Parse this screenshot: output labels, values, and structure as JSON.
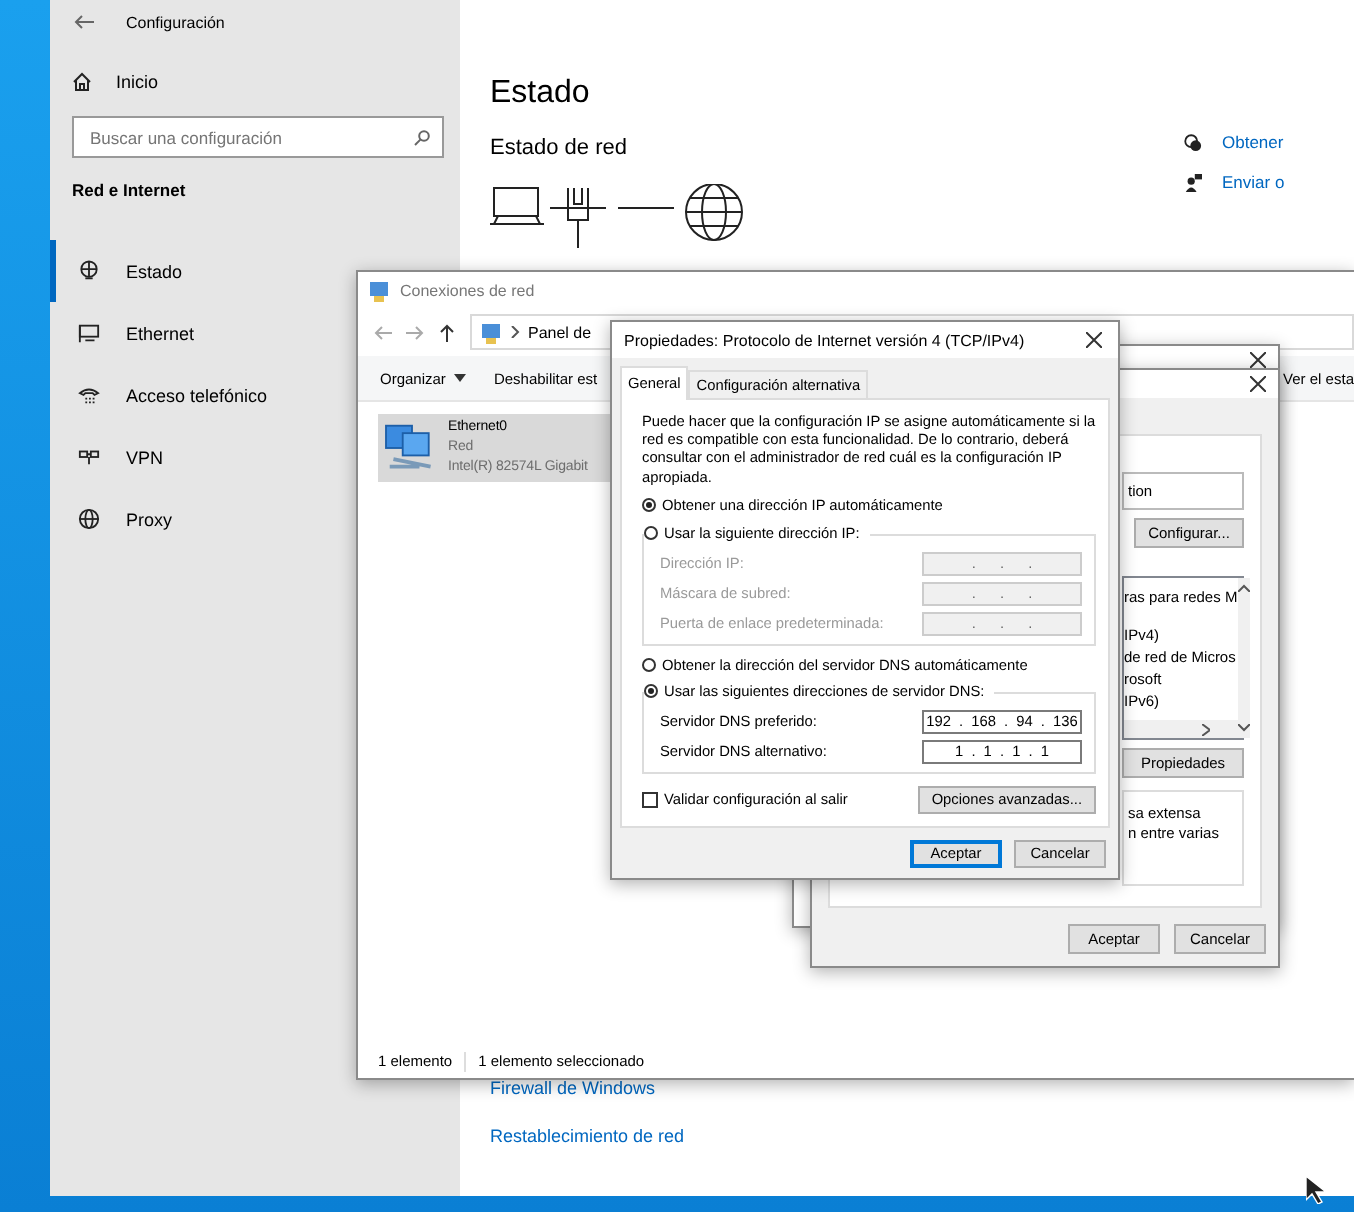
{
  "settings": {
    "title": "Configuración",
    "home": "Inicio",
    "search": {
      "placeholder": "Buscar una configuración"
    },
    "section": "Red e Internet",
    "nav": [
      {
        "label": "Estado",
        "kind": "status",
        "selected": true
      },
      {
        "label": "Ethernet",
        "kind": "ethernet",
        "selected": false
      },
      {
        "label": "Acceso telefónico",
        "kind": "dialup",
        "selected": false
      },
      {
        "label": "VPN",
        "kind": "vpn",
        "selected": false
      },
      {
        "label": "Proxy",
        "kind": "proxy",
        "selected": false
      }
    ],
    "heading": "Estado",
    "subheading": "Estado de red",
    "help_links": [
      {
        "label": "Obtener",
        "kind": "help"
      },
      {
        "label": "Enviar o",
        "kind": "feedback"
      }
    ],
    "links": [
      "Firewall de Windows",
      "Restablecimiento de red"
    ]
  },
  "network_connections": {
    "title": "Conexiones de red",
    "path": "Panel de",
    "toolbar": [
      {
        "label": "Organizar",
        "dropdown": true
      },
      {
        "label": "Deshabilitar est",
        "dropdown": false
      }
    ],
    "toolbar_right": "Ver el esta",
    "items": [
      {
        "name": "Ethernet0",
        "network": "Red",
        "adapter": "Intel(R) 82574L Gigabit",
        "selected": true
      }
    ],
    "status": [
      "1 elemento",
      "1 elemento seleccionado"
    ]
  },
  "adapter_properties": {
    "connection_field": "tion",
    "configure_button": "Configurar...",
    "components": [
      "ras para redes M",
      "IPv4)",
      "de red de Micros",
      "rosoft",
      "IPv6)"
    ],
    "properties_button": "Propiedades",
    "description": [
      "sa extensa",
      "n entre varias"
    ],
    "buttons": [
      "Aceptar",
      "Cancelar"
    ]
  },
  "ipv4_dialog": {
    "title": "Propiedades: Protocolo de Internet versión 4 (TCP/IPv4)",
    "tabs": [
      {
        "label": "General",
        "selected": true
      },
      {
        "label": "Configuración alternativa",
        "selected": false
      }
    ],
    "description": "Puede hacer que la configuración IP se asigne automáticamente si la red es compatible con esta funcionalidad. De lo contrario, deberá consultar con el administrador de red cuál es la configuración IP apropiada.",
    "ip_mode": [
      {
        "label": "Obtener una dirección IP automáticamente",
        "selected": true
      },
      {
        "label": "Usar la siguiente dirección IP:",
        "selected": false
      }
    ],
    "ip_fields": [
      {
        "label": "Dirección IP:",
        "value": ". . .",
        "disabled": true
      },
      {
        "label": "Máscara de subred:",
        "value": ". . .",
        "disabled": true
      },
      {
        "label": "Puerta de enlace predeterminada:",
        "value": ". . .",
        "disabled": true
      }
    ],
    "dns_mode": [
      {
        "label": "Obtener la dirección del servidor DNS automáticamente",
        "selected": false
      },
      {
        "label": "Usar las siguientes direcciones de servidor DNS:",
        "selected": true
      }
    ],
    "dns_fields": [
      {
        "label": "Servidor DNS preferido:",
        "value": "192 . 168 . 94 . 136",
        "disabled": false
      },
      {
        "label": "Servidor DNS alternativo:",
        "value": "1 . 1 . 1 . 1",
        "disabled": false
      }
    ],
    "validate": {
      "label": "Validar configuración al salir",
      "checked": false
    },
    "advanced_button": "Opciones avanzadas...",
    "buttons": [
      {
        "label": "Aceptar",
        "default": true
      },
      {
        "label": "Cancelar",
        "default": false
      }
    ]
  }
}
